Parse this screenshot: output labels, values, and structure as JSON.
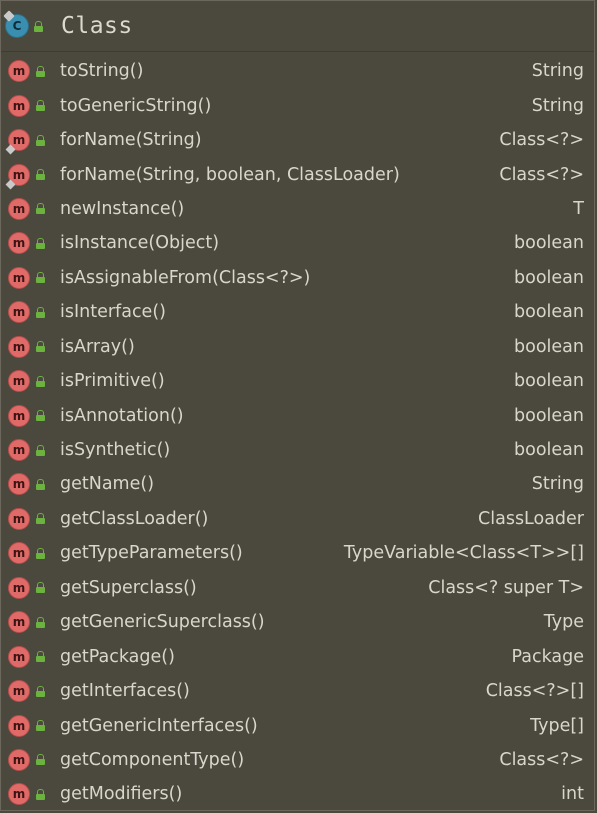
{
  "header": {
    "class_badge": "C",
    "title": "Class"
  },
  "method_badge": "m",
  "methods": [
    {
      "name": "toString()",
      "type": "String",
      "static": false
    },
    {
      "name": "toGenericString()",
      "type": "String",
      "static": false
    },
    {
      "name": "forName(String)",
      "type": "Class<?>",
      "static": true
    },
    {
      "name": "forName(String, boolean, ClassLoader)",
      "type": "Class<?>",
      "static": true
    },
    {
      "name": "newInstance()",
      "type": "T",
      "static": false
    },
    {
      "name": "isInstance(Object)",
      "type": "boolean",
      "static": false
    },
    {
      "name": "isAssignableFrom(Class<?>)",
      "type": "boolean",
      "static": false
    },
    {
      "name": "isInterface()",
      "type": "boolean",
      "static": false
    },
    {
      "name": "isArray()",
      "type": "boolean",
      "static": false
    },
    {
      "name": "isPrimitive()",
      "type": "boolean",
      "static": false
    },
    {
      "name": "isAnnotation()",
      "type": "boolean",
      "static": false
    },
    {
      "name": "isSynthetic()",
      "type": "boolean",
      "static": false
    },
    {
      "name": "getName()",
      "type": "String",
      "static": false
    },
    {
      "name": "getClassLoader()",
      "type": "ClassLoader",
      "static": false
    },
    {
      "name": "getTypeParameters()",
      "type": "TypeVariable<Class<T>>[]",
      "static": false
    },
    {
      "name": "getSuperclass()",
      "type": "Class<? super T>",
      "static": false
    },
    {
      "name": "getGenericSuperclass()",
      "type": "Type",
      "static": false
    },
    {
      "name": "getPackage()",
      "type": "Package",
      "static": false
    },
    {
      "name": "getInterfaces()",
      "type": "Class<?>[]",
      "static": false
    },
    {
      "name": "getGenericInterfaces()",
      "type": "Type[]",
      "static": false
    },
    {
      "name": "getComponentType()",
      "type": "Class<?>",
      "static": false
    },
    {
      "name": "getModifiers()",
      "type": "int",
      "static": false
    }
  ]
}
